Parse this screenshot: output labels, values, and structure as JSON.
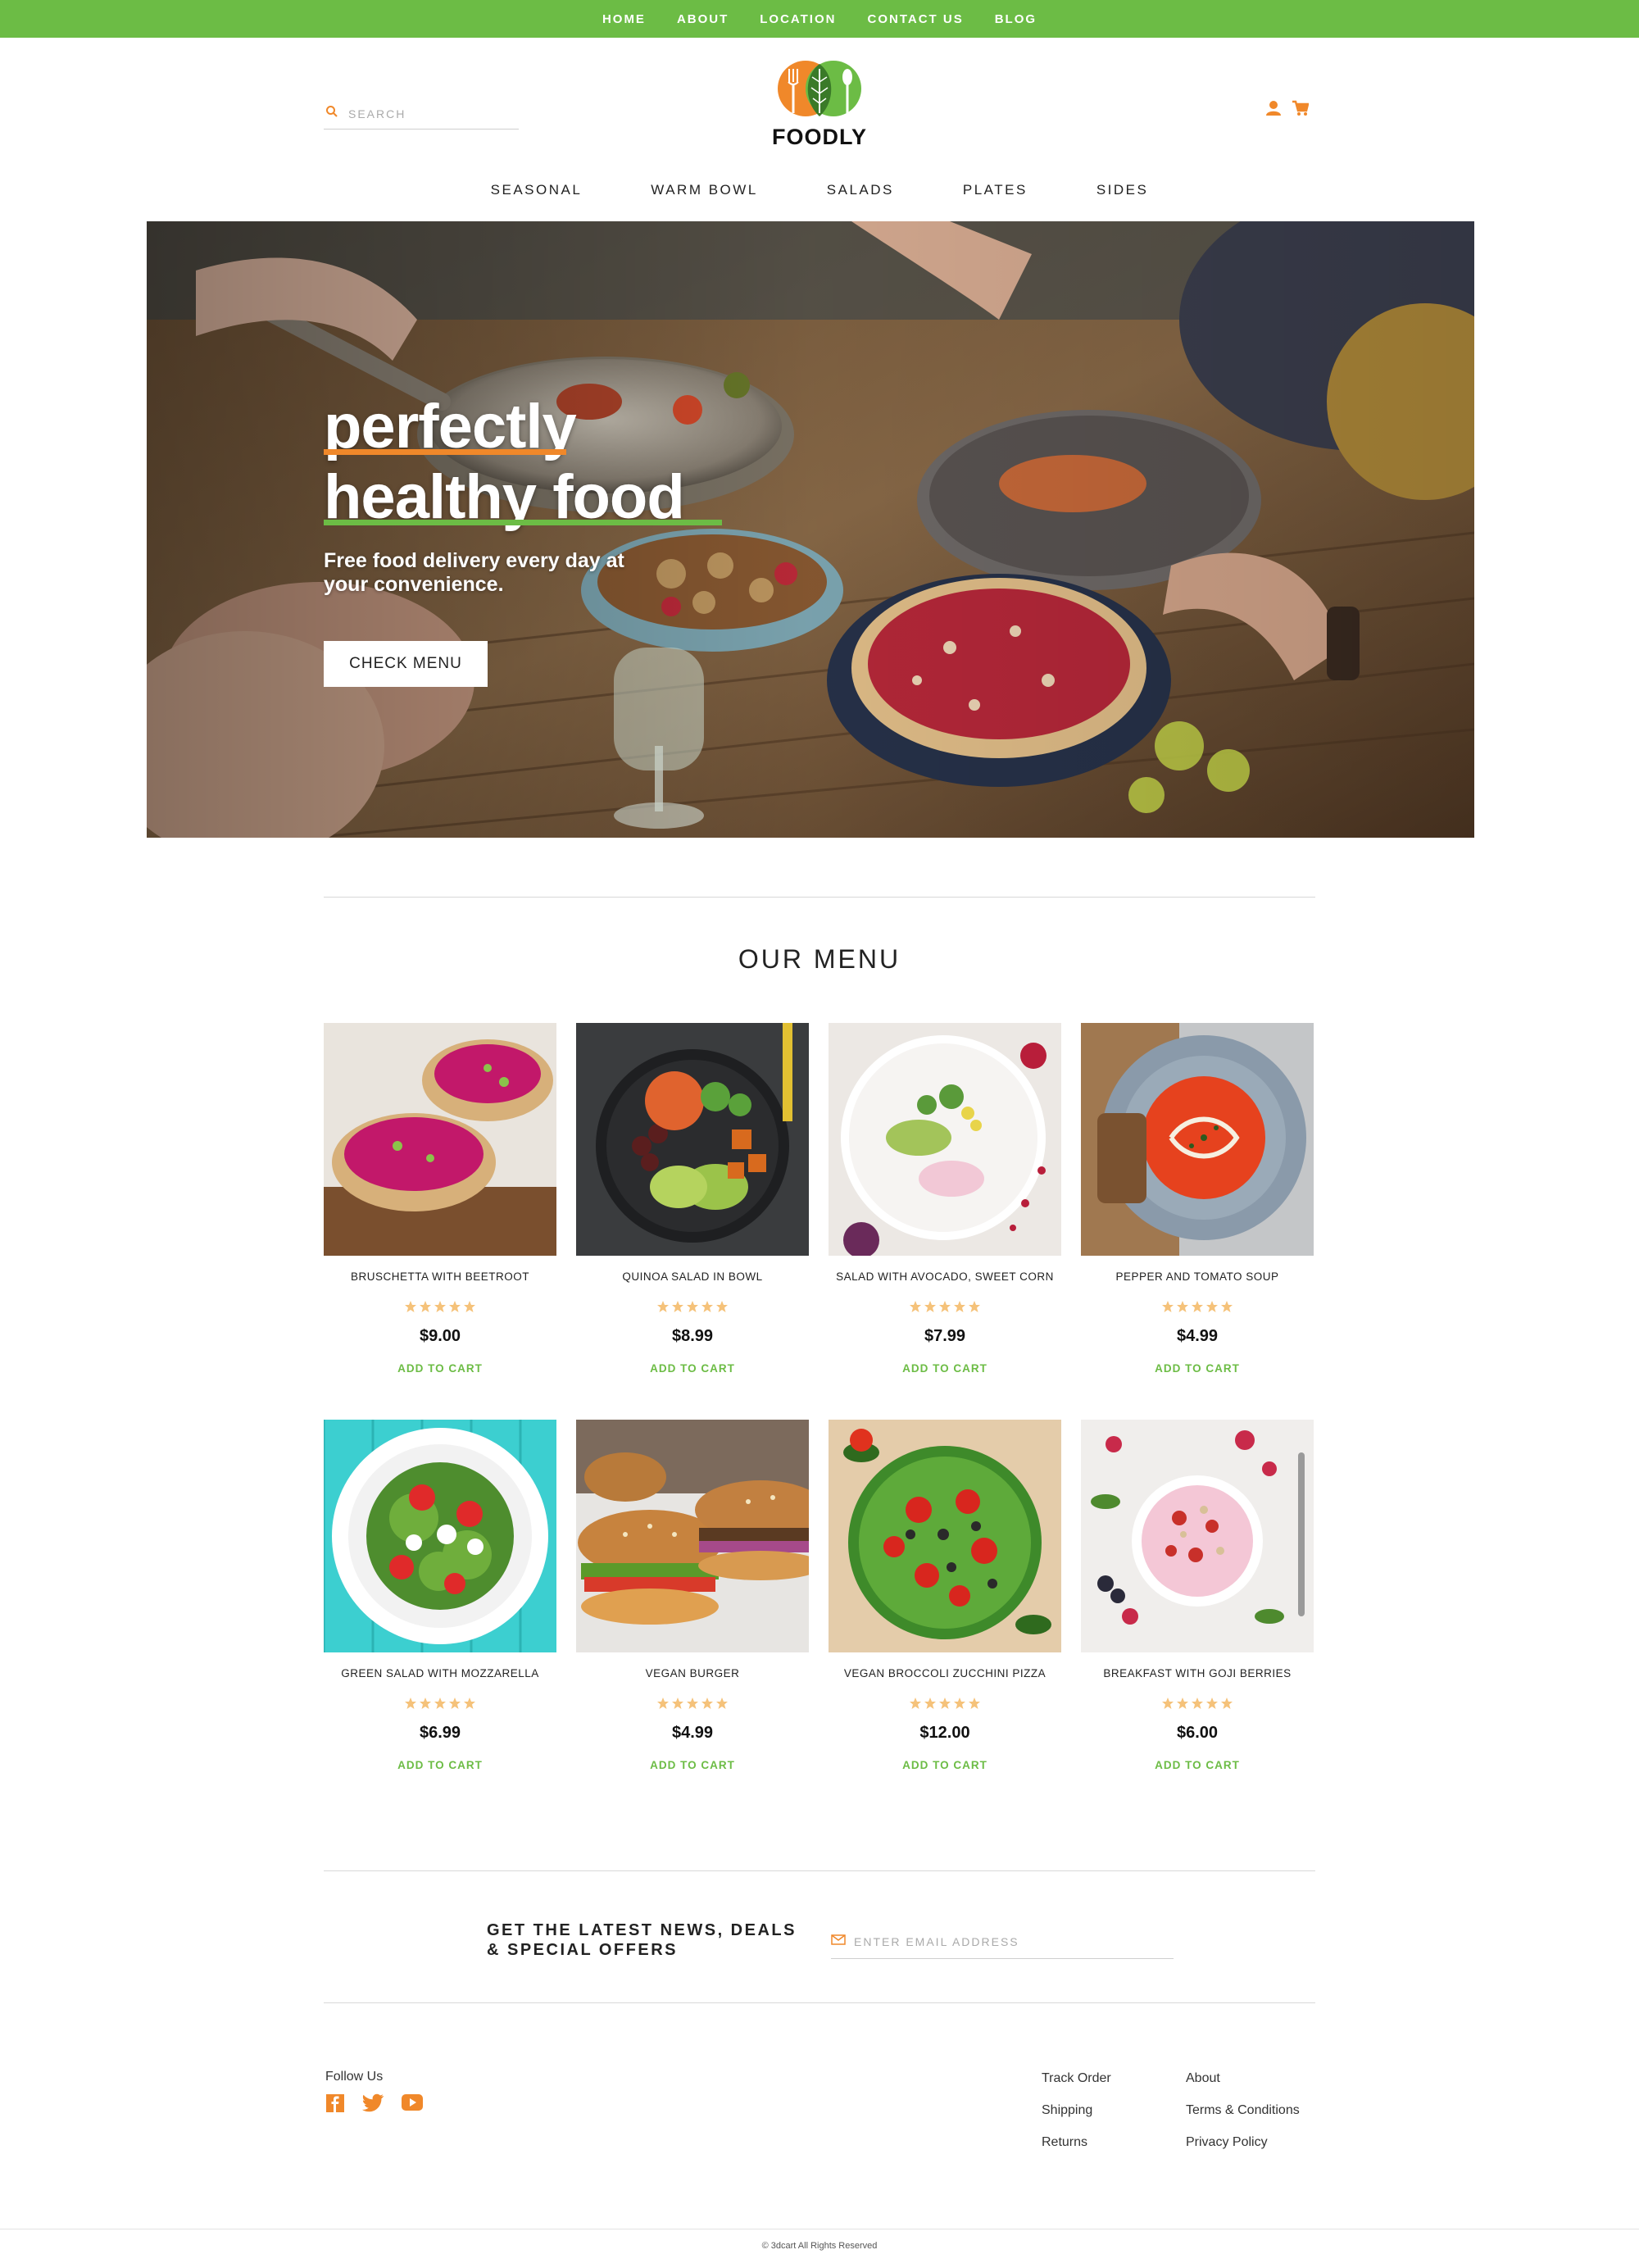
{
  "topnav": [
    "HOME",
    "ABOUT",
    "LOCATION",
    "CONTACT US",
    "BLOG"
  ],
  "search": {
    "placeholder": "SEARCH",
    "icon": "search-icon"
  },
  "logo": {
    "text": "FOODLY"
  },
  "header_icons": [
    "user-icon",
    "cart-icon"
  ],
  "categories": [
    "SEASONAL",
    "WARM BOWL",
    "SALADS",
    "PLATES",
    "SIDES"
  ],
  "hero": {
    "title_line1": "perfectly",
    "title_line2": "healthy food",
    "subtitle": "Free food delivery every day at your convenience.",
    "button": "CHECK MENU"
  },
  "menu": {
    "title": "OUR MENU",
    "add_label": "ADD TO CART",
    "rating": "5",
    "items": [
      {
        "name": "BRUSCHETTA WITH BEETROOT",
        "price": "$9.00"
      },
      {
        "name": "QUINOA SALAD IN BOWL",
        "price": "$8.99"
      },
      {
        "name": "SALAD WITH AVOCADO, SWEET CORN",
        "price": "$7.99"
      },
      {
        "name": "PEPPER AND TOMATO SOUP",
        "price": "$4.99"
      },
      {
        "name": "GREEN SALAD WITH MOZZARELLA",
        "price": "$6.99"
      },
      {
        "name": "VEGAN BURGER",
        "price": "$4.99"
      },
      {
        "name": "VEGAN BROCCOLI ZUCCHINI PIZZA",
        "price": "$12.00"
      },
      {
        "name": "BREAKFAST WITH GOJI BERRIES",
        "price": "$6.00"
      }
    ]
  },
  "newsletter": {
    "title": "GET THE LATEST NEWS, DEALS & SPECIAL OFFERS",
    "placeholder": "ENTER EMAIL ADDRESS"
  },
  "footer": {
    "follow": "Follow Us",
    "socials": [
      "facebook-icon",
      "twitter-icon",
      "youtube-icon"
    ],
    "col1": [
      "Track Order",
      "Shipping",
      "Returns"
    ],
    "col2": [
      "About",
      "Terms & Conditions",
      "Privacy Policy"
    ],
    "copyright": "© 3dcart All Rights Reserved"
  },
  "colors": {
    "accent_green": "#6cbc45",
    "accent_orange": "#f0882a",
    "star": "#f5c27a"
  }
}
